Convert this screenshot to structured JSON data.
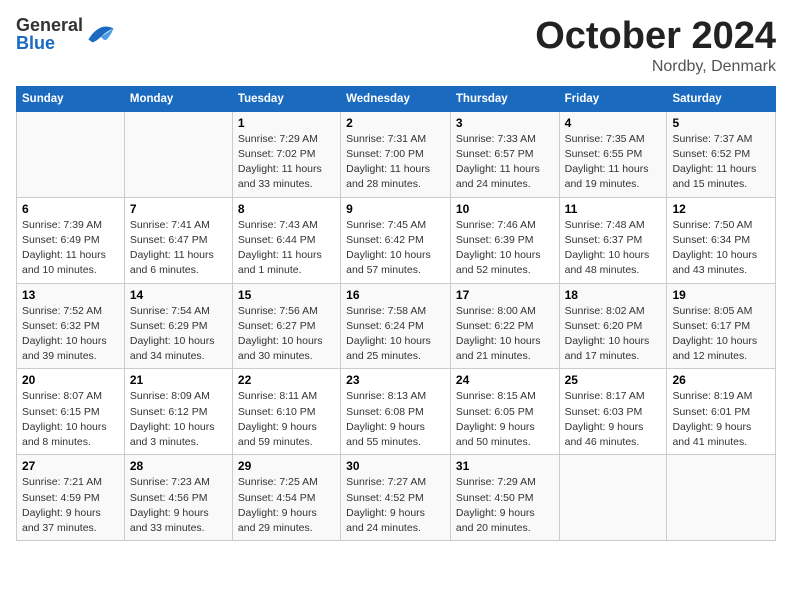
{
  "logo": {
    "general": "General",
    "blue": "Blue"
  },
  "title": "October 2024",
  "subtitle": "Nordby, Denmark",
  "days_header": [
    "Sunday",
    "Monday",
    "Tuesday",
    "Wednesday",
    "Thursday",
    "Friday",
    "Saturday"
  ],
  "weeks": [
    [
      {
        "num": "",
        "info": ""
      },
      {
        "num": "",
        "info": ""
      },
      {
        "num": "1",
        "info": "Sunrise: 7:29 AM\nSunset: 7:02 PM\nDaylight: 11 hours\nand 33 minutes."
      },
      {
        "num": "2",
        "info": "Sunrise: 7:31 AM\nSunset: 7:00 PM\nDaylight: 11 hours\nand 28 minutes."
      },
      {
        "num": "3",
        "info": "Sunrise: 7:33 AM\nSunset: 6:57 PM\nDaylight: 11 hours\nand 24 minutes."
      },
      {
        "num": "4",
        "info": "Sunrise: 7:35 AM\nSunset: 6:55 PM\nDaylight: 11 hours\nand 19 minutes."
      },
      {
        "num": "5",
        "info": "Sunrise: 7:37 AM\nSunset: 6:52 PM\nDaylight: 11 hours\nand 15 minutes."
      }
    ],
    [
      {
        "num": "6",
        "info": "Sunrise: 7:39 AM\nSunset: 6:49 PM\nDaylight: 11 hours\nand 10 minutes."
      },
      {
        "num": "7",
        "info": "Sunrise: 7:41 AM\nSunset: 6:47 PM\nDaylight: 11 hours\nand 6 minutes."
      },
      {
        "num": "8",
        "info": "Sunrise: 7:43 AM\nSunset: 6:44 PM\nDaylight: 11 hours\nand 1 minute."
      },
      {
        "num": "9",
        "info": "Sunrise: 7:45 AM\nSunset: 6:42 PM\nDaylight: 10 hours\nand 57 minutes."
      },
      {
        "num": "10",
        "info": "Sunrise: 7:46 AM\nSunset: 6:39 PM\nDaylight: 10 hours\nand 52 minutes."
      },
      {
        "num": "11",
        "info": "Sunrise: 7:48 AM\nSunset: 6:37 PM\nDaylight: 10 hours\nand 48 minutes."
      },
      {
        "num": "12",
        "info": "Sunrise: 7:50 AM\nSunset: 6:34 PM\nDaylight: 10 hours\nand 43 minutes."
      }
    ],
    [
      {
        "num": "13",
        "info": "Sunrise: 7:52 AM\nSunset: 6:32 PM\nDaylight: 10 hours\nand 39 minutes."
      },
      {
        "num": "14",
        "info": "Sunrise: 7:54 AM\nSunset: 6:29 PM\nDaylight: 10 hours\nand 34 minutes."
      },
      {
        "num": "15",
        "info": "Sunrise: 7:56 AM\nSunset: 6:27 PM\nDaylight: 10 hours\nand 30 minutes."
      },
      {
        "num": "16",
        "info": "Sunrise: 7:58 AM\nSunset: 6:24 PM\nDaylight: 10 hours\nand 25 minutes."
      },
      {
        "num": "17",
        "info": "Sunrise: 8:00 AM\nSunset: 6:22 PM\nDaylight: 10 hours\nand 21 minutes."
      },
      {
        "num": "18",
        "info": "Sunrise: 8:02 AM\nSunset: 6:20 PM\nDaylight: 10 hours\nand 17 minutes."
      },
      {
        "num": "19",
        "info": "Sunrise: 8:05 AM\nSunset: 6:17 PM\nDaylight: 10 hours\nand 12 minutes."
      }
    ],
    [
      {
        "num": "20",
        "info": "Sunrise: 8:07 AM\nSunset: 6:15 PM\nDaylight: 10 hours\nand 8 minutes."
      },
      {
        "num": "21",
        "info": "Sunrise: 8:09 AM\nSunset: 6:12 PM\nDaylight: 10 hours\nand 3 minutes."
      },
      {
        "num": "22",
        "info": "Sunrise: 8:11 AM\nSunset: 6:10 PM\nDaylight: 9 hours\nand 59 minutes."
      },
      {
        "num": "23",
        "info": "Sunrise: 8:13 AM\nSunset: 6:08 PM\nDaylight: 9 hours\nand 55 minutes."
      },
      {
        "num": "24",
        "info": "Sunrise: 8:15 AM\nSunset: 6:05 PM\nDaylight: 9 hours\nand 50 minutes."
      },
      {
        "num": "25",
        "info": "Sunrise: 8:17 AM\nSunset: 6:03 PM\nDaylight: 9 hours\nand 46 minutes."
      },
      {
        "num": "26",
        "info": "Sunrise: 8:19 AM\nSunset: 6:01 PM\nDaylight: 9 hours\nand 41 minutes."
      }
    ],
    [
      {
        "num": "27",
        "info": "Sunrise: 7:21 AM\nSunset: 4:59 PM\nDaylight: 9 hours\nand 37 minutes."
      },
      {
        "num": "28",
        "info": "Sunrise: 7:23 AM\nSunset: 4:56 PM\nDaylight: 9 hours\nand 33 minutes."
      },
      {
        "num": "29",
        "info": "Sunrise: 7:25 AM\nSunset: 4:54 PM\nDaylight: 9 hours\nand 29 minutes."
      },
      {
        "num": "30",
        "info": "Sunrise: 7:27 AM\nSunset: 4:52 PM\nDaylight: 9 hours\nand 24 minutes."
      },
      {
        "num": "31",
        "info": "Sunrise: 7:29 AM\nSunset: 4:50 PM\nDaylight: 9 hours\nand 20 minutes."
      },
      {
        "num": "",
        "info": ""
      },
      {
        "num": "",
        "info": ""
      }
    ]
  ]
}
